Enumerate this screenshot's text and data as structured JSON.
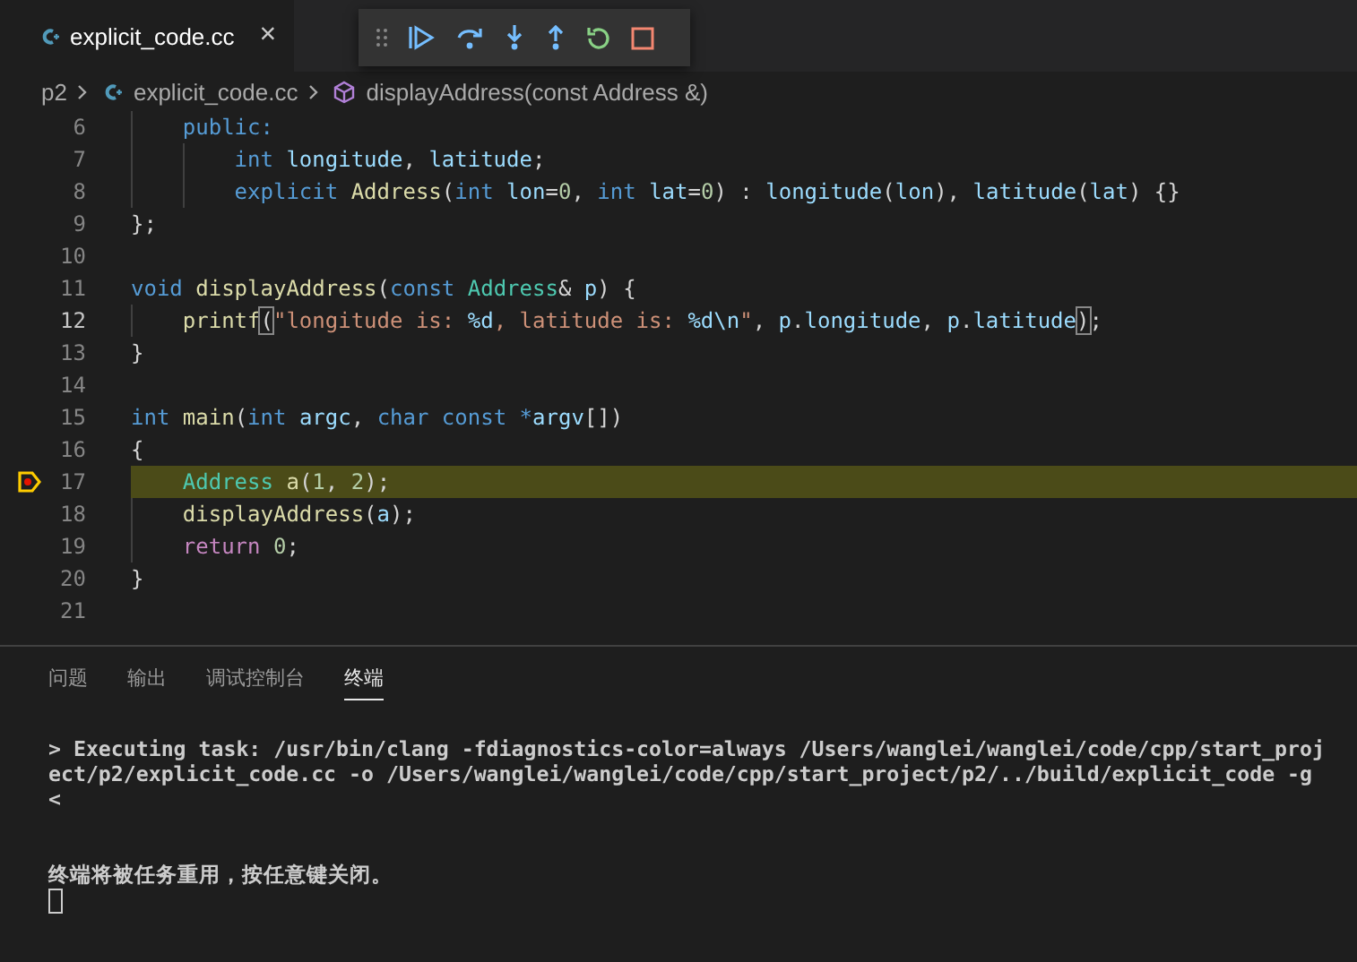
{
  "editor_tab": {
    "label": "explicit_code.cc",
    "close": "×",
    "selected": true
  },
  "debug_toolbar": {
    "buttons": [
      {
        "kind": "continue"
      },
      {
        "kind": "step-over"
      },
      {
        "kind": "step-into"
      },
      {
        "kind": "step-out"
      },
      {
        "kind": "restart"
      },
      {
        "kind": "stop"
      }
    ]
  },
  "breadcrumb": [
    {
      "kind": "folder",
      "label": "p2"
    },
    {
      "kind": "file",
      "label": "explicit_code.cc"
    },
    {
      "kind": "symbol",
      "label": "displayAddress(const Address &)"
    }
  ],
  "code_lines": [
    {
      "number": "6",
      "active": false,
      "current": false,
      "tokens": [
        {
          "text": "    public:",
          "kind": "keyword"
        }
      ]
    },
    {
      "number": "7",
      "active": false,
      "current": false,
      "tokens": [
        {
          "text": "        int ",
          "kind": "keyword"
        },
        {
          "text": "longitude",
          "kind": "variable"
        },
        {
          "text": ", ",
          "kind": "plain"
        },
        {
          "text": "latitude",
          "kind": "variable"
        },
        {
          "text": ";",
          "kind": "plain"
        }
      ]
    },
    {
      "number": "8",
      "active": false,
      "current": false,
      "tokens": [
        {
          "text": "        explicit ",
          "kind": "keyword"
        },
        {
          "text": "Address",
          "kind": "function"
        },
        {
          "text": "(",
          "kind": "plain"
        },
        {
          "text": "int ",
          "kind": "keyword"
        },
        {
          "text": "lon",
          "kind": "variable"
        },
        {
          "text": "=",
          "kind": "plain"
        },
        {
          "text": "0",
          "kind": "number"
        },
        {
          "text": ", ",
          "kind": "plain"
        },
        {
          "text": "int ",
          "kind": "keyword"
        },
        {
          "text": "lat",
          "kind": "variable"
        },
        {
          "text": "=",
          "kind": "plain"
        },
        {
          "text": "0",
          "kind": "number"
        },
        {
          "text": ") : ",
          "kind": "plain"
        },
        {
          "text": "longitude",
          "kind": "variable"
        },
        {
          "text": "(",
          "kind": "plain"
        },
        {
          "text": "lon",
          "kind": "variable"
        },
        {
          "text": "), ",
          "kind": "plain"
        },
        {
          "text": "latitude",
          "kind": "variable"
        },
        {
          "text": "(",
          "kind": "plain"
        },
        {
          "text": "lat",
          "kind": "variable"
        },
        {
          "text": ") {}",
          "kind": "plain"
        }
      ]
    },
    {
      "number": "9",
      "active": false,
      "current": false,
      "tokens": [
        {
          "text": "};",
          "kind": "plain"
        }
      ]
    },
    {
      "number": "10",
      "active": false,
      "current": false
    },
    {
      "number": "11",
      "active": false,
      "current": false,
      "tokens": [
        {
          "text": "void ",
          "kind": "keyword"
        },
        {
          "text": "displayAddress",
          "kind": "function"
        },
        {
          "text": "(",
          "kind": "plain"
        },
        {
          "text": "const ",
          "kind": "keyword"
        },
        {
          "text": "Address",
          "kind": "type"
        },
        {
          "text": "& ",
          "kind": "plain"
        },
        {
          "text": "p",
          "kind": "variable"
        },
        {
          "text": ") {",
          "kind": "plain"
        }
      ]
    },
    {
      "number": "12",
      "active": true,
      "current": false,
      "tokens": [
        {
          "text": "    printf",
          "kind": "function"
        },
        {
          "text": "(",
          "kind": "bracket"
        },
        {
          "text": "\"longitude is: ",
          "kind": "string"
        },
        {
          "text": "%d",
          "kind": "variable"
        },
        {
          "text": ", latitude is: ",
          "kind": "string"
        },
        {
          "text": "%d\\n",
          "kind": "variable"
        },
        {
          "text": "\"",
          "kind": "string"
        },
        {
          "text": ", ",
          "kind": "plain"
        },
        {
          "text": "p",
          "kind": "variable"
        },
        {
          "text": ".",
          "kind": "plain"
        },
        {
          "text": "longitude",
          "kind": "variable"
        },
        {
          "text": ", ",
          "kind": "plain"
        },
        {
          "text": "p",
          "kind": "variable"
        },
        {
          "text": ".",
          "kind": "plain"
        },
        {
          "text": "latitude",
          "kind": "variable"
        },
        {
          "text": ")",
          "kind": "bracket"
        },
        {
          "text": ";",
          "kind": "plain"
        }
      ]
    },
    {
      "number": "13",
      "active": false,
      "current": false,
      "tokens": [
        {
          "text": "}",
          "kind": "plain"
        }
      ]
    },
    {
      "number": "14",
      "active": false,
      "current": false
    },
    {
      "number": "15",
      "active": false,
      "current": false,
      "tokens": [
        {
          "text": "int ",
          "kind": "keyword"
        },
        {
          "text": "main",
          "kind": "function"
        },
        {
          "text": "(",
          "kind": "plain"
        },
        {
          "text": "int ",
          "kind": "keyword"
        },
        {
          "text": "argc",
          "kind": "variable"
        },
        {
          "text": ", ",
          "kind": "plain"
        },
        {
          "text": "char const *",
          "kind": "keyword"
        },
        {
          "text": "argv",
          "kind": "variable"
        },
        {
          "text": "[])",
          "kind": "plain"
        }
      ]
    },
    {
      "number": "16",
      "active": false,
      "current": false,
      "tokens": [
        {
          "text": "{",
          "kind": "plain"
        }
      ]
    },
    {
      "number": "17",
      "active": false,
      "current": true,
      "tokens": [
        {
          "text": "    Address ",
          "kind": "type"
        },
        {
          "text": "a",
          "kind": "function"
        },
        {
          "text": "(",
          "kind": "plain"
        },
        {
          "text": "1",
          "kind": "number"
        },
        {
          "text": ", ",
          "kind": "plain"
        },
        {
          "text": "2",
          "kind": "number"
        },
        {
          "text": ");",
          "kind": "plain"
        }
      ]
    },
    {
      "number": "18",
      "active": false,
      "current": false,
      "tokens": [
        {
          "text": "    displayAddress",
          "kind": "function"
        },
        {
          "text": "(",
          "kind": "plain"
        },
        {
          "text": "a",
          "kind": "variable"
        },
        {
          "text": ");",
          "kind": "plain"
        }
      ]
    },
    {
      "number": "19",
      "active": false,
      "current": false,
      "tokens": [
        {
          "text": "    return ",
          "kind": "control"
        },
        {
          "text": "0",
          "kind": "number"
        },
        {
          "text": ";",
          "kind": "plain"
        }
      ]
    },
    {
      "number": "20",
      "active": false,
      "current": false,
      "tokens": [
        {
          "text": "}",
          "kind": "plain"
        }
      ]
    },
    {
      "number": "21",
      "active": false,
      "current": false
    }
  ],
  "panel_tabs": [
    {
      "label": "问题",
      "selected": false
    },
    {
      "label": "输出",
      "selected": false
    },
    {
      "label": "调试控制台",
      "selected": false
    },
    {
      "label": "终端",
      "selected": true
    }
  ],
  "terminal": {
    "lines": [
      "> Executing task: /usr/bin/clang -fdiagnostics-color=always /Users/wanglei/wanglei/code/cpp/start_proj",
      "ect/p2/explicit_code.cc -o /Users/wanglei/wanglei/code/cpp/start_project/p2/../build/explicit_code -g",
      "<",
      "终端将被任务重用，按任意键关闭。"
    ],
    "cursor": true
  }
}
